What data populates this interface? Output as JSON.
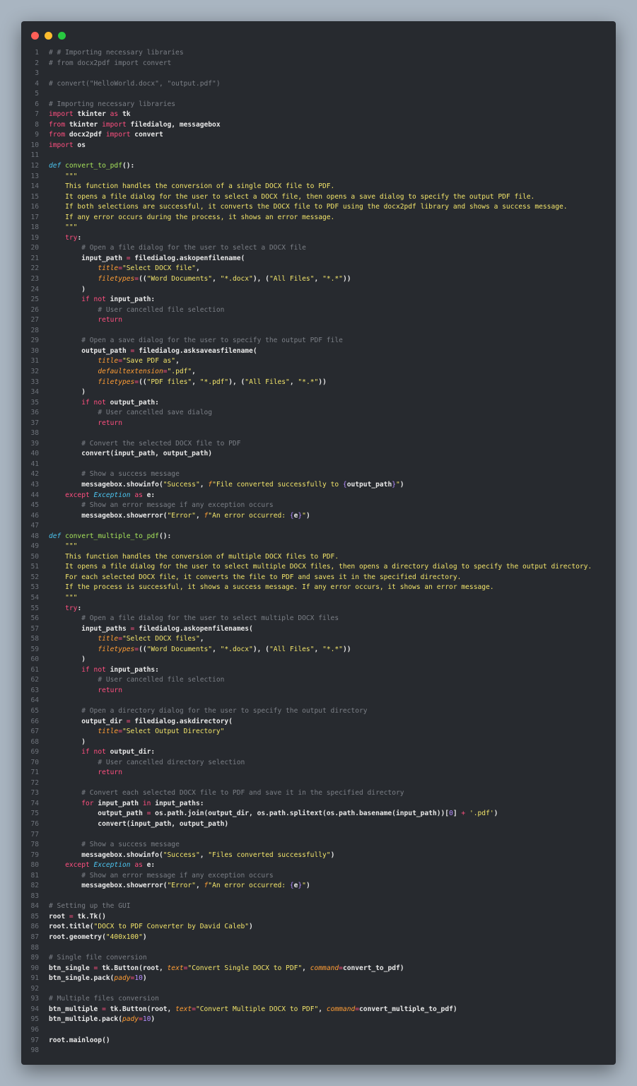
{
  "window": {
    "controls": [
      "close",
      "minimize",
      "zoom"
    ]
  },
  "lines": [
    [
      [
        "cm",
        "# # Importing necessary libraries"
      ]
    ],
    [
      [
        "cm",
        "# from docx2pdf import convert"
      ]
    ],
    [],
    [
      [
        "cm",
        "# convert(\"HelloWorld.docx\", \"output.pdf\")"
      ]
    ],
    [],
    [
      [
        "cm",
        "# Importing necessary libraries"
      ]
    ],
    [
      [
        "kw",
        "import"
      ],
      [
        "t",
        " tkinter "
      ],
      [
        "kw",
        "as"
      ],
      [
        "t",
        " tk"
      ]
    ],
    [
      [
        "kw",
        "from"
      ],
      [
        "t",
        " tkinter "
      ],
      [
        "kw",
        "import"
      ],
      [
        "t",
        " filedialog, messagebox"
      ]
    ],
    [
      [
        "kw",
        "from"
      ],
      [
        "t",
        " docx2pdf "
      ],
      [
        "kw",
        "import"
      ],
      [
        "t",
        " convert"
      ]
    ],
    [
      [
        "kw",
        "import"
      ],
      [
        "t",
        " os"
      ]
    ],
    [],
    [
      [
        "def",
        "def"
      ],
      [
        "t",
        " "
      ],
      [
        "fn",
        "convert_to_pdf"
      ],
      [
        "t",
        "():"
      ]
    ],
    [
      [
        "t",
        "    "
      ],
      [
        "doc",
        "\"\"\""
      ]
    ],
    [
      [
        "doc",
        "    This function handles the conversion of a single DOCX file to PDF."
      ]
    ],
    [
      [
        "doc",
        "    It opens a file dialog for the user to select a DOCX file, then opens a save dialog to specify the output PDF file."
      ]
    ],
    [
      [
        "doc",
        "    If both selections are successful, it converts the DOCX file to PDF using the docx2pdf library and shows a success message."
      ]
    ],
    [
      [
        "doc",
        "    If any error occurs during the process, it shows an error message."
      ]
    ],
    [
      [
        "t",
        "    "
      ],
      [
        "doc",
        "\"\"\""
      ]
    ],
    [
      [
        "t",
        "    "
      ],
      [
        "kw",
        "try"
      ],
      [
        "t",
        ":"
      ]
    ],
    [
      [
        "t",
        "        "
      ],
      [
        "cm",
        "# Open a file dialog for the user to select a DOCX file"
      ]
    ],
    [
      [
        "t",
        "        input_path "
      ],
      [
        "op",
        "="
      ],
      [
        "t",
        " filedialog.askopenfilename("
      ]
    ],
    [
      [
        "t",
        "            "
      ],
      [
        "arg",
        "title"
      ],
      [
        "op",
        "="
      ],
      [
        "str",
        "\"Select DOCX file\""
      ],
      [
        "t",
        ","
      ]
    ],
    [
      [
        "t",
        "            "
      ],
      [
        "arg",
        "filetypes"
      ],
      [
        "op",
        "="
      ],
      [
        "t",
        "(("
      ],
      [
        "str",
        "\"Word Documents\""
      ],
      [
        "t",
        ", "
      ],
      [
        "str",
        "\"*.docx\""
      ],
      [
        "t",
        "), ("
      ],
      [
        "str",
        "\"All Files\""
      ],
      [
        "t",
        ", "
      ],
      [
        "str",
        "\"*.*\""
      ],
      [
        "t",
        "))"
      ]
    ],
    [
      [
        "t",
        "        )"
      ]
    ],
    [
      [
        "t",
        "        "
      ],
      [
        "kw",
        "if not"
      ],
      [
        "t",
        " input_path:"
      ]
    ],
    [
      [
        "t",
        "            "
      ],
      [
        "cm",
        "# User cancelled file selection"
      ]
    ],
    [
      [
        "t",
        "            "
      ],
      [
        "kw",
        "return"
      ]
    ],
    [],
    [
      [
        "t",
        "        "
      ],
      [
        "cm",
        "# Open a save dialog for the user to specify the output PDF file"
      ]
    ],
    [
      [
        "t",
        "        output_path "
      ],
      [
        "op",
        "="
      ],
      [
        "t",
        " filedialog.asksaveasfilename("
      ]
    ],
    [
      [
        "t",
        "            "
      ],
      [
        "arg",
        "title"
      ],
      [
        "op",
        "="
      ],
      [
        "str",
        "\"Save PDF as\""
      ],
      [
        "t",
        ","
      ]
    ],
    [
      [
        "t",
        "            "
      ],
      [
        "arg",
        "defaultextension"
      ],
      [
        "op",
        "="
      ],
      [
        "str",
        "\".pdf\""
      ],
      [
        "t",
        ","
      ]
    ],
    [
      [
        "t",
        "            "
      ],
      [
        "arg",
        "filetypes"
      ],
      [
        "op",
        "="
      ],
      [
        "t",
        "(("
      ],
      [
        "str",
        "\"PDF files\""
      ],
      [
        "t",
        ", "
      ],
      [
        "str",
        "\"*.pdf\""
      ],
      [
        "t",
        "), ("
      ],
      [
        "str",
        "\"All Files\""
      ],
      [
        "t",
        ", "
      ],
      [
        "str",
        "\"*.*\""
      ],
      [
        "t",
        "))"
      ]
    ],
    [
      [
        "t",
        "        )"
      ]
    ],
    [
      [
        "t",
        "        "
      ],
      [
        "kw",
        "if not"
      ],
      [
        "t",
        " output_path:"
      ]
    ],
    [
      [
        "t",
        "            "
      ],
      [
        "cm",
        "# User cancelled save dialog"
      ]
    ],
    [
      [
        "t",
        "            "
      ],
      [
        "kw",
        "return"
      ]
    ],
    [],
    [
      [
        "t",
        "        "
      ],
      [
        "cm",
        "# Convert the selected DOCX file to PDF"
      ]
    ],
    [
      [
        "t",
        "        convert(input_path, output_path)"
      ]
    ],
    [],
    [
      [
        "t",
        "        "
      ],
      [
        "cm",
        "# Show a success message"
      ]
    ],
    [
      [
        "t",
        "        messagebox.showinfo("
      ],
      [
        "str",
        "\"Success\""
      ],
      [
        "t",
        ", "
      ],
      [
        "arg",
        "f"
      ],
      [
        "str",
        "\"File converted successfully to "
      ],
      [
        "num",
        "{"
      ],
      [
        "t",
        "output_path"
      ],
      [
        "num",
        "}"
      ],
      [
        "str",
        "\""
      ],
      [
        "t",
        ")"
      ]
    ],
    [
      [
        "t",
        "    "
      ],
      [
        "kw",
        "except"
      ],
      [
        "t",
        " "
      ],
      [
        "cls",
        "Exception"
      ],
      [
        "t",
        " "
      ],
      [
        "kw",
        "as"
      ],
      [
        "t",
        " e:"
      ]
    ],
    [
      [
        "t",
        "        "
      ],
      [
        "cm",
        "# Show an error message if any exception occurs"
      ]
    ],
    [
      [
        "t",
        "        messagebox.showerror("
      ],
      [
        "str",
        "\"Error\""
      ],
      [
        "t",
        ", "
      ],
      [
        "arg",
        "f"
      ],
      [
        "str",
        "\"An error occurred: "
      ],
      [
        "num",
        "{"
      ],
      [
        "t",
        "e"
      ],
      [
        "num",
        "}"
      ],
      [
        "str",
        "\""
      ],
      [
        "t",
        ")"
      ]
    ],
    [],
    [
      [
        "def",
        "def"
      ],
      [
        "t",
        " "
      ],
      [
        "fn",
        "convert_multiple_to_pdf"
      ],
      [
        "t",
        "():"
      ]
    ],
    [
      [
        "t",
        "    "
      ],
      [
        "doc",
        "\"\"\""
      ]
    ],
    [
      [
        "doc",
        "    This function handles the conversion of multiple DOCX files to PDF."
      ]
    ],
    [
      [
        "doc",
        "    It opens a file dialog for the user to select multiple DOCX files, then opens a directory dialog to specify the output directory."
      ]
    ],
    [
      [
        "doc",
        "    For each selected DOCX file, it converts the file to PDF and saves it in the specified directory."
      ]
    ],
    [
      [
        "doc",
        "    If the process is successful, it shows a success message. If any error occurs, it shows an error message."
      ]
    ],
    [
      [
        "t",
        "    "
      ],
      [
        "doc",
        "\"\"\""
      ]
    ],
    [
      [
        "t",
        "    "
      ],
      [
        "kw",
        "try"
      ],
      [
        "t",
        ":"
      ]
    ],
    [
      [
        "t",
        "        "
      ],
      [
        "cm",
        "# Open a file dialog for the user to select multiple DOCX files"
      ]
    ],
    [
      [
        "t",
        "        input_paths "
      ],
      [
        "op",
        "="
      ],
      [
        "t",
        " filedialog.askopenfilenames("
      ]
    ],
    [
      [
        "t",
        "            "
      ],
      [
        "arg",
        "title"
      ],
      [
        "op",
        "="
      ],
      [
        "str",
        "\"Select DOCX files\""
      ],
      [
        "t",
        ","
      ]
    ],
    [
      [
        "t",
        "            "
      ],
      [
        "arg",
        "filetypes"
      ],
      [
        "op",
        "="
      ],
      [
        "t",
        "(("
      ],
      [
        "str",
        "\"Word Documents\""
      ],
      [
        "t",
        ", "
      ],
      [
        "str",
        "\"*.docx\""
      ],
      [
        "t",
        "), ("
      ],
      [
        "str",
        "\"All Files\""
      ],
      [
        "t",
        ", "
      ],
      [
        "str",
        "\"*.*\""
      ],
      [
        "t",
        "))"
      ]
    ],
    [
      [
        "t",
        "        )"
      ]
    ],
    [
      [
        "t",
        "        "
      ],
      [
        "kw",
        "if not"
      ],
      [
        "t",
        " input_paths:"
      ]
    ],
    [
      [
        "t",
        "            "
      ],
      [
        "cm",
        "# User cancelled file selection"
      ]
    ],
    [
      [
        "t",
        "            "
      ],
      [
        "kw",
        "return"
      ]
    ],
    [],
    [
      [
        "t",
        "        "
      ],
      [
        "cm",
        "# Open a directory dialog for the user to specify the output directory"
      ]
    ],
    [
      [
        "t",
        "        output_dir "
      ],
      [
        "op",
        "="
      ],
      [
        "t",
        " filedialog.askdirectory("
      ]
    ],
    [
      [
        "t",
        "            "
      ],
      [
        "arg",
        "title"
      ],
      [
        "op",
        "="
      ],
      [
        "str",
        "\"Select Output Directory\""
      ]
    ],
    [
      [
        "t",
        "        )"
      ]
    ],
    [
      [
        "t",
        "        "
      ],
      [
        "kw",
        "if not"
      ],
      [
        "t",
        " output_dir:"
      ]
    ],
    [
      [
        "t",
        "            "
      ],
      [
        "cm",
        "# User cancelled directory selection"
      ]
    ],
    [
      [
        "t",
        "            "
      ],
      [
        "kw",
        "return"
      ]
    ],
    [],
    [
      [
        "t",
        "        "
      ],
      [
        "cm",
        "# Convert each selected DOCX file to PDF and save it in the specified directory"
      ]
    ],
    [
      [
        "t",
        "        "
      ],
      [
        "kw",
        "for"
      ],
      [
        "t",
        " input_path "
      ],
      [
        "kw",
        "in"
      ],
      [
        "t",
        " input_paths:"
      ]
    ],
    [
      [
        "t",
        "            output_path "
      ],
      [
        "op",
        "="
      ],
      [
        "t",
        " os.path.join(output_dir, os.path.splitext(os.path.basename(input_path))["
      ],
      [
        "num",
        "0"
      ],
      [
        "t",
        "] "
      ],
      [
        "op",
        "+"
      ],
      [
        "t",
        " "
      ],
      [
        "str",
        "'.pdf'"
      ],
      [
        "t",
        ")"
      ]
    ],
    [
      [
        "t",
        "            convert(input_path, output_path)"
      ]
    ],
    [],
    [
      [
        "t",
        "        "
      ],
      [
        "cm",
        "# Show a success message"
      ]
    ],
    [
      [
        "t",
        "        messagebox.showinfo("
      ],
      [
        "str",
        "\"Success\""
      ],
      [
        "t",
        ", "
      ],
      [
        "str",
        "\"Files converted successfully\""
      ],
      [
        "t",
        ")"
      ]
    ],
    [
      [
        "t",
        "    "
      ],
      [
        "kw",
        "except"
      ],
      [
        "t",
        " "
      ],
      [
        "cls",
        "Exception"
      ],
      [
        "t",
        " "
      ],
      [
        "kw",
        "as"
      ],
      [
        "t",
        " e:"
      ]
    ],
    [
      [
        "t",
        "        "
      ],
      [
        "cm",
        "# Show an error message if any exception occurs"
      ]
    ],
    [
      [
        "t",
        "        messagebox.showerror("
      ],
      [
        "str",
        "\"Error\""
      ],
      [
        "t",
        ", "
      ],
      [
        "arg",
        "f"
      ],
      [
        "str",
        "\"An error occurred: "
      ],
      [
        "num",
        "{"
      ],
      [
        "t",
        "e"
      ],
      [
        "num",
        "}"
      ],
      [
        "str",
        "\""
      ],
      [
        "t",
        ")"
      ]
    ],
    [],
    [
      [
        "cm",
        "# Setting up the GUI"
      ]
    ],
    [
      [
        "t",
        "root "
      ],
      [
        "op",
        "="
      ],
      [
        "t",
        " tk.Tk()"
      ]
    ],
    [
      [
        "t",
        "root.title("
      ],
      [
        "str",
        "\"DOCX to PDF Converter by David Caleb\""
      ],
      [
        "t",
        ")"
      ]
    ],
    [
      [
        "t",
        "root.geometry("
      ],
      [
        "str",
        "\"400x100\""
      ],
      [
        "t",
        ")"
      ]
    ],
    [],
    [
      [
        "cm",
        "# Single file conversion"
      ]
    ],
    [
      [
        "t",
        "btn_single "
      ],
      [
        "op",
        "="
      ],
      [
        "t",
        " tk.Button(root, "
      ],
      [
        "arg",
        "text"
      ],
      [
        "op",
        "="
      ],
      [
        "str",
        "\"Convert Single DOCX to PDF\""
      ],
      [
        "t",
        ", "
      ],
      [
        "arg",
        "command"
      ],
      [
        "op",
        "="
      ],
      [
        "t",
        "convert_to_pdf)"
      ]
    ],
    [
      [
        "t",
        "btn_single.pack("
      ],
      [
        "arg",
        "pady"
      ],
      [
        "op",
        "="
      ],
      [
        "num",
        "10"
      ],
      [
        "t",
        ")"
      ]
    ],
    [],
    [
      [
        "cm",
        "# Multiple files conversion"
      ]
    ],
    [
      [
        "t",
        "btn_multiple "
      ],
      [
        "op",
        "="
      ],
      [
        "t",
        " tk.Button(root, "
      ],
      [
        "arg",
        "text"
      ],
      [
        "op",
        "="
      ],
      [
        "str",
        "\"Convert Multiple DOCX to PDF\""
      ],
      [
        "t",
        ", "
      ],
      [
        "arg",
        "command"
      ],
      [
        "op",
        "="
      ],
      [
        "t",
        "convert_multiple_to_pdf)"
      ]
    ],
    [
      [
        "t",
        "btn_multiple.pack("
      ],
      [
        "arg",
        "pady"
      ],
      [
        "op",
        "="
      ],
      [
        "num",
        "10"
      ],
      [
        "t",
        ")"
      ]
    ],
    [],
    [
      [
        "t",
        "root.mainloop()"
      ]
    ],
    []
  ]
}
